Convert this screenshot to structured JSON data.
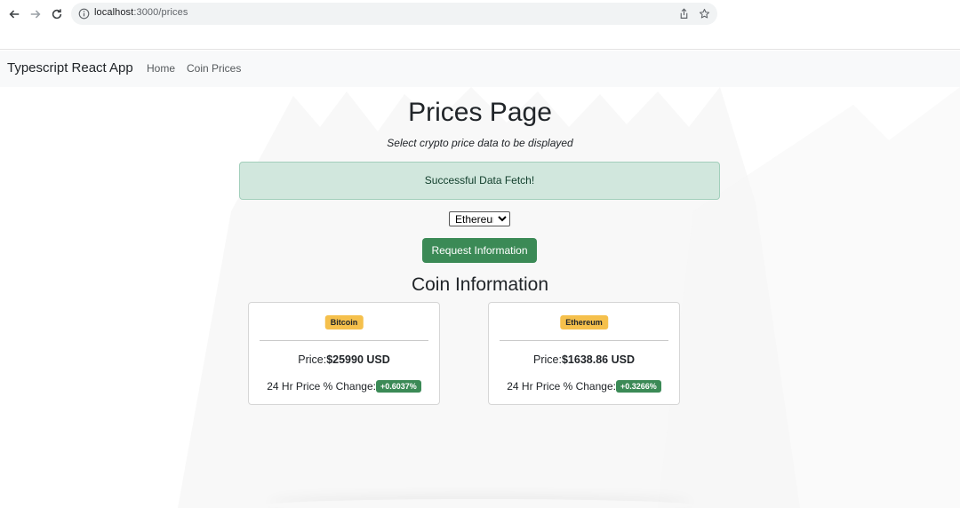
{
  "browser": {
    "url_host": "localhost",
    "url_path": ":3000/prices"
  },
  "navbar": {
    "brand": "Typescript React App",
    "links": [
      {
        "label": "Home"
      },
      {
        "label": "Coin Prices"
      }
    ]
  },
  "page": {
    "title": "Prices Page",
    "subtitle": "Select crypto price data to be displayed",
    "alert": "Successful Data Fetch!",
    "select": {
      "selected": "Ethereum"
    },
    "request_button": "Request Information",
    "section_title": "Coin Information"
  },
  "cards": [
    {
      "name": "Bitcoin",
      "price_label": "Price:",
      "price_value": "$25990 USD",
      "change_label": "24 Hr Price % Change:",
      "change_value": "+0.6037%"
    },
    {
      "name": "Ethereum",
      "price_label": "Price:",
      "price_value": "$1638.86 USD",
      "change_label": "24 Hr Price % Change:",
      "change_value": "+0.3266%"
    }
  ],
  "colors": {
    "alert_bg": "#d1e7dd",
    "button_green": "#3b8a56",
    "badge_yellow": "#f5c04c",
    "navbar_bg": "#f8f9fa"
  },
  "icons": [
    "back-arrow-icon",
    "forward-arrow-icon",
    "reload-icon",
    "info-icon",
    "share-icon",
    "bookmark-star-icon"
  ]
}
